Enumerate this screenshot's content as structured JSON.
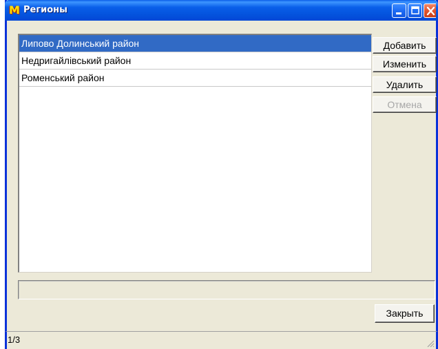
{
  "window": {
    "title": "Регионы",
    "icon": "app-m-icon"
  },
  "titlebar_buttons": {
    "minimize": "minimize-icon",
    "maximize": "maximize-icon",
    "close": "close-icon"
  },
  "list": {
    "items": [
      {
        "label": "Липово Долинський район",
        "selected": true
      },
      {
        "label": "Недригайлівський район",
        "selected": false
      },
      {
        "label": "Роменський район",
        "selected": false
      }
    ]
  },
  "actions": {
    "add_label": "Добавить",
    "edit_label": "Изменить",
    "delete_label": "Удалить",
    "cancel_label": "Отмена",
    "close_label": "Закрыть"
  },
  "status": {
    "position": "1/3",
    "input_value": ""
  },
  "colors": {
    "selection": "#316ac5",
    "titlebar": "#0453dd",
    "window_bg": "#ece9d8"
  }
}
